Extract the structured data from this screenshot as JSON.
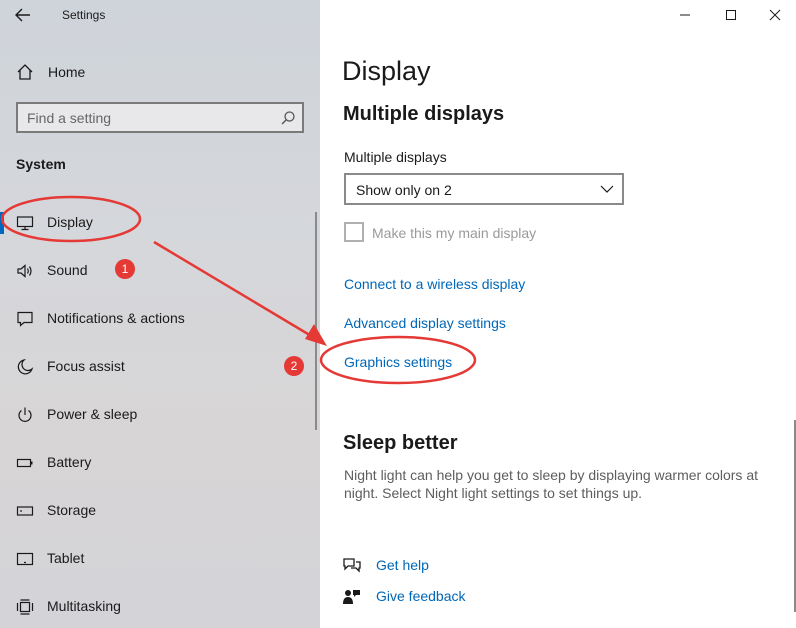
{
  "app": {
    "title": "Settings"
  },
  "left": {
    "home_label": "Home",
    "search_placeholder": "Find a setting",
    "section_heading": "System",
    "items": [
      {
        "label": "Display",
        "icon": "monitor-icon"
      },
      {
        "label": "Sound",
        "icon": "speaker-icon"
      },
      {
        "label": "Notifications & actions",
        "icon": "notification-icon"
      },
      {
        "label": "Focus assist",
        "icon": "moon-icon"
      },
      {
        "label": "Power & sleep",
        "icon": "power-icon"
      },
      {
        "label": "Battery",
        "icon": "battery-icon"
      },
      {
        "label": "Storage",
        "icon": "storage-icon"
      },
      {
        "label": "Tablet",
        "icon": "tablet-icon"
      },
      {
        "label": "Multitasking",
        "icon": "multitasking-icon"
      }
    ]
  },
  "main": {
    "title": "Display",
    "subtitle": "Multiple displays",
    "field_label": "Multiple displays",
    "dropdown_value": "Show only on 2",
    "checkbox_label": "Make this my main display",
    "links": [
      "Connect to a wireless display",
      "Advanced display settings",
      "Graphics settings"
    ],
    "sleep_title": "Sleep better",
    "sleep_text": "Night light can help you get to sleep by displaying warmer colors at night. Select Night light settings to set things up.",
    "help": {
      "get_help": "Get help",
      "give_feedback": "Give feedback"
    }
  },
  "annotations": {
    "badge_1": "1",
    "badge_2": "2"
  },
  "colors": {
    "accent": "#0067c0",
    "link": "#0067b8",
    "annotation": "#e53935"
  }
}
